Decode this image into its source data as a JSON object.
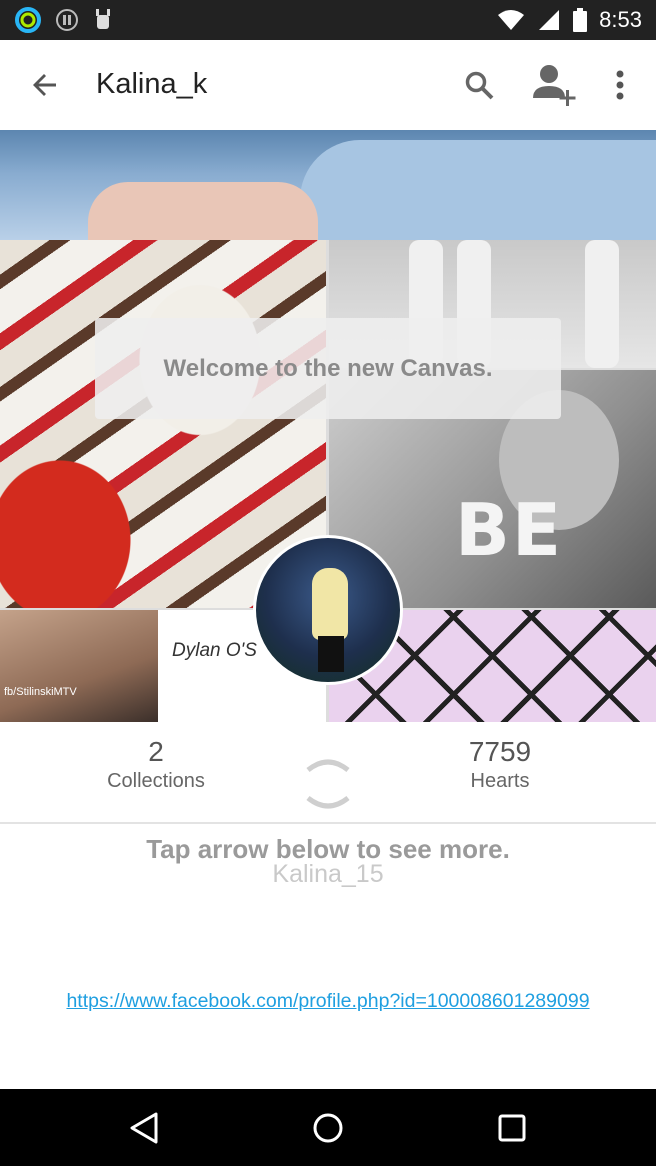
{
  "status_bar": {
    "time": "8:53",
    "left_icons": [
      "ring-app-icon",
      "pause-circle-icon",
      "android-debug-icon"
    ],
    "right_icons": [
      "wifi-icon",
      "signal-icon",
      "battery-icon"
    ]
  },
  "app_bar": {
    "title": "Kalina_k",
    "icons": [
      "back-arrow-icon",
      "search-icon",
      "add-person-icon",
      "more-vert-icon"
    ]
  },
  "collage": {
    "tiles": [
      "arm-photo",
      "kinder-chocolate-photo",
      "ballet-feet-photo",
      "be-yourself-photo",
      "dylan-photo",
      "pink-pattern-photo"
    ],
    "dylan_caption": "Dylan O'S",
    "dylan_tag": "fb/StilinskiMTV",
    "be_text": "BE"
  },
  "welcome_banner": "Welcome to the new Canvas.",
  "stats": {
    "collections_count": "2",
    "collections_label": "Collections",
    "hearts_count": "7759",
    "hearts_label": "Hearts"
  },
  "hint": "Tap arrow below to see more.",
  "username_secondary": "Kalina_15",
  "profile_link": "https://www.facebook.com/profile.php?id=100008601289099",
  "nav_bar": {
    "icons": [
      "nav-back-icon",
      "nav-home-icon",
      "nav-recents-icon"
    ]
  },
  "colors": {
    "status_bar": "#222222",
    "link": "#1f9fe0",
    "nav_bar": "#000000"
  }
}
